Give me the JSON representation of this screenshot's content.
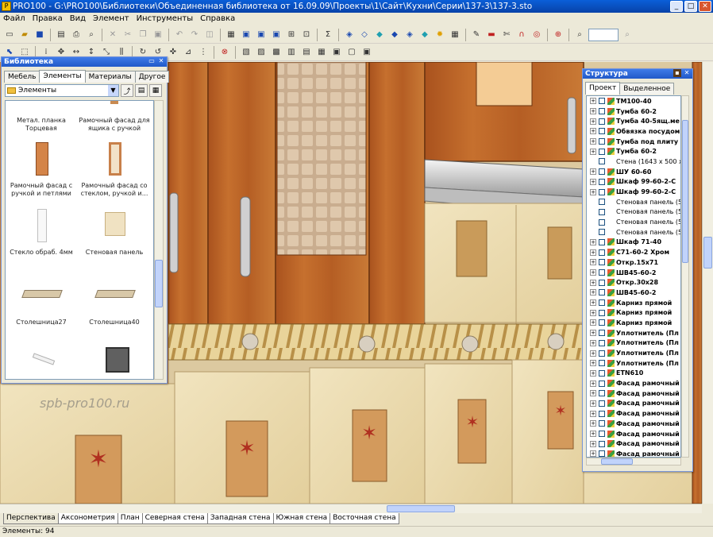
{
  "window": {
    "title": "PRO100 - G:\\PRO100\\Библиотеки\\Объединенная библиотека от 16.09.09\\Проекты\\1\\Сайт\\Кухни\\Серии\\137-3\\137-3.sto"
  },
  "menu": [
    "Файл",
    "Правка",
    "Вид",
    "Элемент",
    "Инструменты",
    "Справка"
  ],
  "toolbar": {
    "zoom": "",
    "icons": [
      "new-icon",
      "open-icon",
      "save-icon",
      "print-icon",
      "cut-icon",
      "copy-icon",
      "paste-icon",
      "undo-icon",
      "redo-icon",
      "sum-icon",
      "cube-icon",
      "light-icon",
      "magnet-icon",
      "select-icon",
      "move-icon",
      "rotate-icon",
      "zoom-icon"
    ]
  },
  "watermark": "spb-pro100.ru",
  "library": {
    "title": "Библиотека",
    "tabs": [
      "Мебель",
      "Элементы",
      "Материалы",
      "Другое"
    ],
    "active_tab": "Элементы",
    "folder": "Элементы",
    "items": [
      "Метал. планка Торцевая",
      "Рамочный фасад для ящика с ручкой",
      "Рамочный фасад с ручкой и петлями",
      "Рамочный фасад со стеклом, ручкой и...",
      "Стекло обраб. 4мм",
      "Стеновая панель",
      "Столешница27",
      "Столешница40",
      "",
      ""
    ]
  },
  "structure": {
    "title": "Структура",
    "tabs": [
      "Проект",
      "Выделенное"
    ],
    "active_tab": "Проект",
    "items": [
      {
        "label": "ТМ100-40",
        "bold": true
      },
      {
        "label": "Тумба 60-2",
        "bold": true
      },
      {
        "label": "Тумба 40-5ящ.ме",
        "bold": true
      },
      {
        "label": "Обвязка посудом",
        "bold": true
      },
      {
        "label": "Тумба под плиту",
        "bold": true
      },
      {
        "label": "Тумба 60-2",
        "bold": true
      },
      {
        "label": "Стена  (1643 x 500 x 5(",
        "bold": false
      },
      {
        "label": "ШУ 60-60",
        "bold": true
      },
      {
        "label": "Шкаф 99-60-2-С",
        "bold": true
      },
      {
        "label": "Шкаф 99-60-2-С",
        "bold": true
      },
      {
        "label": "Стеновая панель  (50 :",
        "bold": false
      },
      {
        "label": "Стеновая панель  (50 :",
        "bold": false
      },
      {
        "label": "Стеновая панель  (50 :",
        "bold": false
      },
      {
        "label": "Стеновая панель  (50 :",
        "bold": false
      },
      {
        "label": "Шкаф 71-40",
        "bold": true
      },
      {
        "label": "С71-60-2 Хром",
        "bold": true
      },
      {
        "label": "Откр.15х71",
        "bold": true
      },
      {
        "label": "ШВ45-60-2",
        "bold": true
      },
      {
        "label": "Откр.30х28",
        "bold": true
      },
      {
        "label": "ШВ45-60-2",
        "bold": true
      },
      {
        "label": "Карниз прямой",
        "bold": true
      },
      {
        "label": "Карниз прямой",
        "bold": true
      },
      {
        "label": "Карниз прямой",
        "bold": true
      },
      {
        "label": "Уплотнитель (Пл",
        "bold": true
      },
      {
        "label": "Уплотнитель (Пл",
        "bold": true
      },
      {
        "label": "Уплотнитель (Пл",
        "bold": true
      },
      {
        "label": "Уплотнитель (Пл",
        "bold": true
      },
      {
        "label": "ETN610",
        "bold": true
      },
      {
        "label": "Фасад рамочный",
        "bold": true
      },
      {
        "label": "Фасад рамочный",
        "bold": true
      },
      {
        "label": "Фасад рамочный",
        "bold": true
      },
      {
        "label": "Фасад рамочный",
        "bold": true
      },
      {
        "label": "Фасад рамочный",
        "bold": true
      },
      {
        "label": "Фасад рамочный",
        "bold": true
      },
      {
        "label": "Фасад рамочный",
        "bold": true
      },
      {
        "label": "Фасад рамочный",
        "bold": true
      }
    ]
  },
  "view_tabs": [
    "Перспектива",
    "Аксонометрия",
    "План",
    "Северная стена",
    "Западная стена",
    "Южная стена",
    "Восточная стена"
  ],
  "active_view": "Перспектива",
  "status": "Элементы: 94"
}
